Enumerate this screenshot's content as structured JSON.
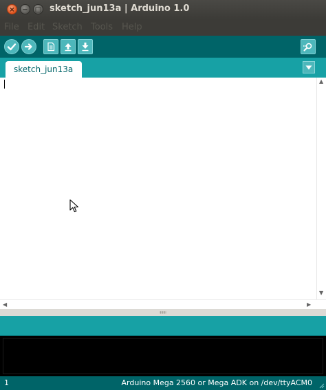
{
  "window": {
    "title": "sketch_jun13a | Arduino 1.0",
    "close_glyph": "×",
    "min_glyph": "−",
    "max_glyph": "□"
  },
  "menu": {
    "items": [
      "File",
      "Edit",
      "Sketch",
      "Tools",
      "Help"
    ]
  },
  "toolbar": {
    "buttons": [
      "verify-icon",
      "upload-icon",
      "new-icon",
      "open-icon",
      "save-icon",
      "serial-monitor-icon"
    ]
  },
  "tabs": {
    "items": [
      {
        "label": "sketch_jun13a"
      }
    ],
    "menu_icon": "triangle-down-icon"
  },
  "editor": {
    "content": ""
  },
  "status": {
    "line": "1",
    "board": "Arduino Mega 2560 or Mega ADK on /dev/ttyACM0"
  },
  "colors": {
    "toolbar": "#006468",
    "tabstrip": "#17a1a5",
    "button": "#4db7bb",
    "console": "#000000",
    "titlebar": "#3c3b37"
  }
}
